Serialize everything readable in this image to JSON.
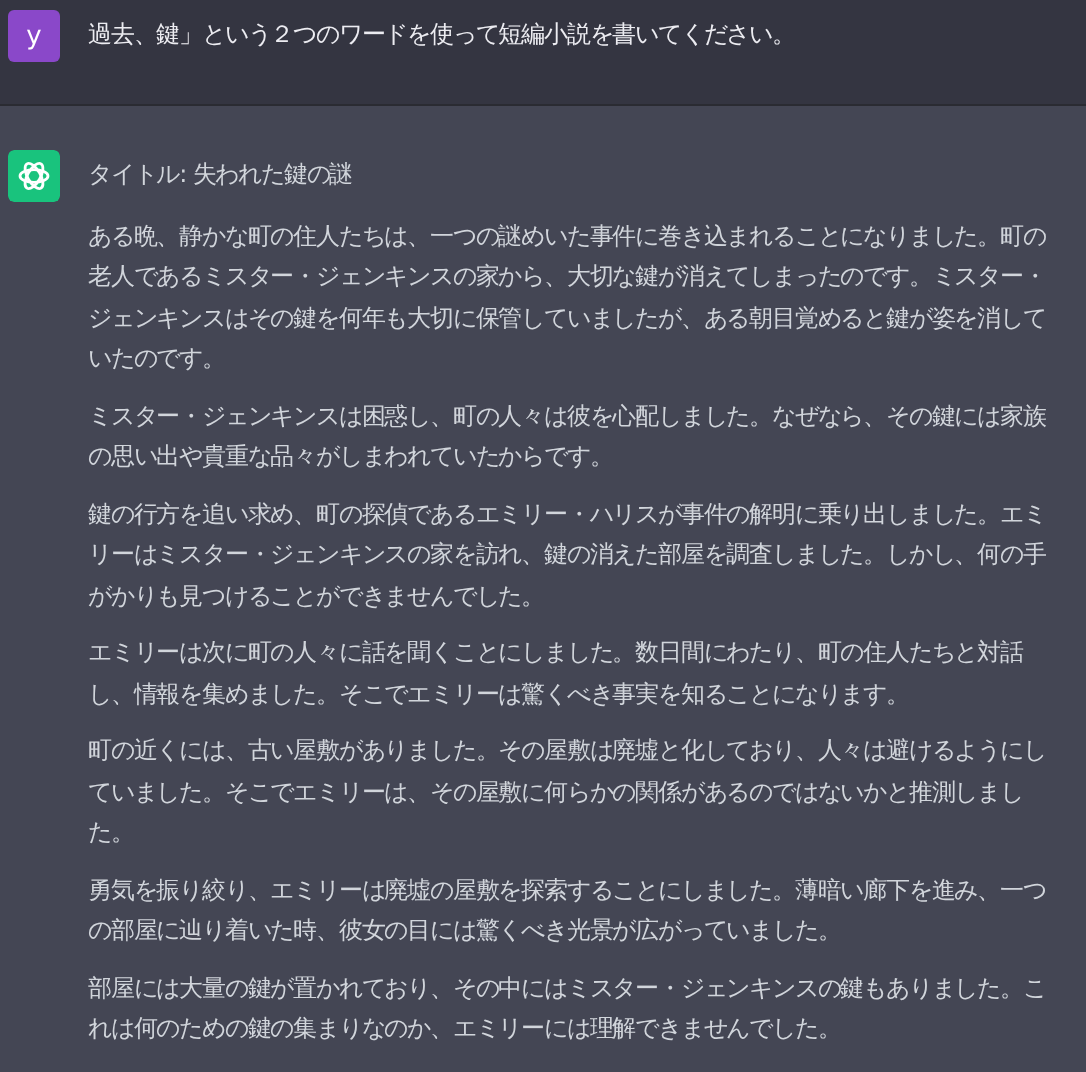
{
  "messages": [
    {
      "kind": "user",
      "avatar": "y",
      "paragraphs": [
        "過去、鍵」という２つのワードを使って短編小説を書いてください。"
      ]
    },
    {
      "kind": "assistant",
      "paragraphs": [
        "タイトル: 失われた鍵の謎",
        "ある晩、静かな町の住人たちは、一つの謎めいた事件に巻き込まれることになりました。町の老人であるミスター・ジェンキンスの家から、大切な鍵が消えてしまったのです。ミスター・ジェンキンスはその鍵を何年も大切に保管していましたが、ある朝目覚めると鍵が姿を消していたのです。",
        "ミスター・ジェンキンスは困惑し、町の人々は彼を心配しました。なぜなら、その鍵には家族の思い出や貴重な品々がしまわれていたからです。",
        "鍵の行方を追い求め、町の探偵であるエミリー・ハリスが事件の解明に乗り出しました。エミリーはミスター・ジェンキンスの家を訪れ、鍵の消えた部屋を調査しました。しかし、何の手がかりも見つけることができませんでした。",
        "エミリーは次に町の人々に話を聞くことにしました。数日間にわたり、町の住人たちと対話し、情報を集めました。そこでエミリーは驚くべき事実を知ることになります。",
        "町の近くには、古い屋敷がありました。その屋敷は廃墟と化しており、人々は避けるようにしていました。そこでエミリーは、その屋敷に何らかの関係があるのではないかと推測しました。",
        "勇気を振り絞り、エミリーは廃墟の屋敷を探索することにしました。薄暗い廊下を進み、一つの部屋に辿り着いた時、彼女の目には驚くべき光景が広がっていました。",
        "部屋には大量の鍵が置かれており、その中にはミスター・ジェンキンスの鍵もありました。これは何のための鍵の集まりなのか、エミリーには理解できませんでした。"
      ]
    }
  ]
}
